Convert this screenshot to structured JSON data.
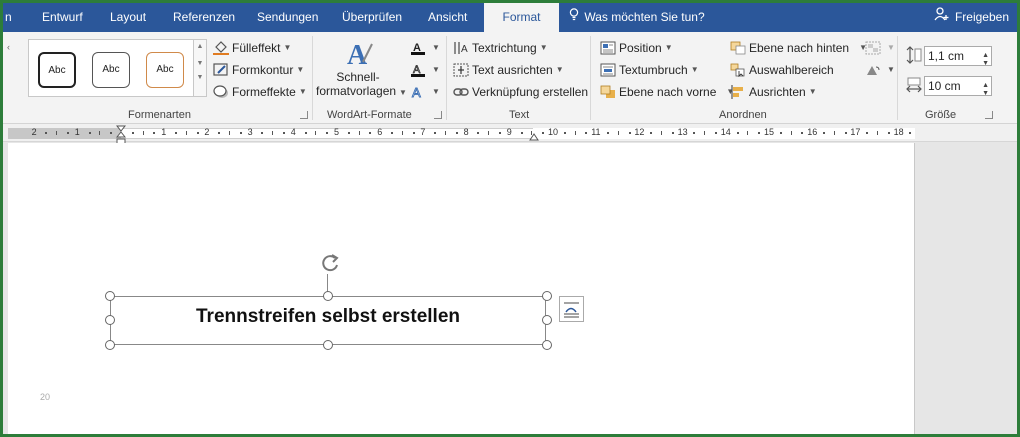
{
  "tabs": [
    {
      "label": "n",
      "active": false
    },
    {
      "label": "Entwurf",
      "active": false
    },
    {
      "label": "Layout",
      "active": false
    },
    {
      "label": "Referenzen",
      "active": false
    },
    {
      "label": "Sendungen",
      "active": false
    },
    {
      "label": "Überprüfen",
      "active": false
    },
    {
      "label": "Ansicht",
      "active": false
    },
    {
      "label": "Format",
      "active": true
    }
  ],
  "tellme": "Was möchten Sie tun?",
  "share": "Freigeben",
  "ribbon": {
    "formenarten": {
      "label": "Formenarten",
      "styles": [
        "Abc",
        "Abc",
        "Abc"
      ],
      "fill": "Fülleffekt",
      "outline": "Formkontur",
      "effects": "Formeffekte"
    },
    "wordart": {
      "label": "WordArt-Formate",
      "quick_line1": "Schnell-",
      "quick_line2": "formatvorlagen"
    },
    "text": {
      "label": "Text",
      "direction": "Textrichtung",
      "align": "Text ausrichten",
      "link": "Verknüpfung erstellen"
    },
    "anordnen": {
      "label": "Anordnen",
      "position": "Position",
      "wrap": "Textumbruch",
      "forward": "Ebene nach vorne",
      "backward": "Ebene nach hinten",
      "selection_pane": "Auswahlbereich",
      "align": "Ausrichten"
    },
    "groesse": {
      "label": "Größe",
      "height": "1,1 cm",
      "width": "10 cm"
    }
  },
  "ruler": {
    "left_numbers": [
      "2",
      "1"
    ],
    "numbers": [
      "1",
      "2",
      "3",
      "4",
      "5",
      "6",
      "7",
      "8",
      "9",
      "10",
      "11",
      "12",
      "13",
      "14",
      "15",
      "16",
      "17",
      "18"
    ]
  },
  "document": {
    "textbox_text": "Trennstreifen selbst erstellen",
    "page_number": "20"
  },
  "colors": {
    "tab_bar": "#2b579a",
    "frame": "#2d7d3a",
    "ribbon_bg": "#f3f3f3"
  }
}
